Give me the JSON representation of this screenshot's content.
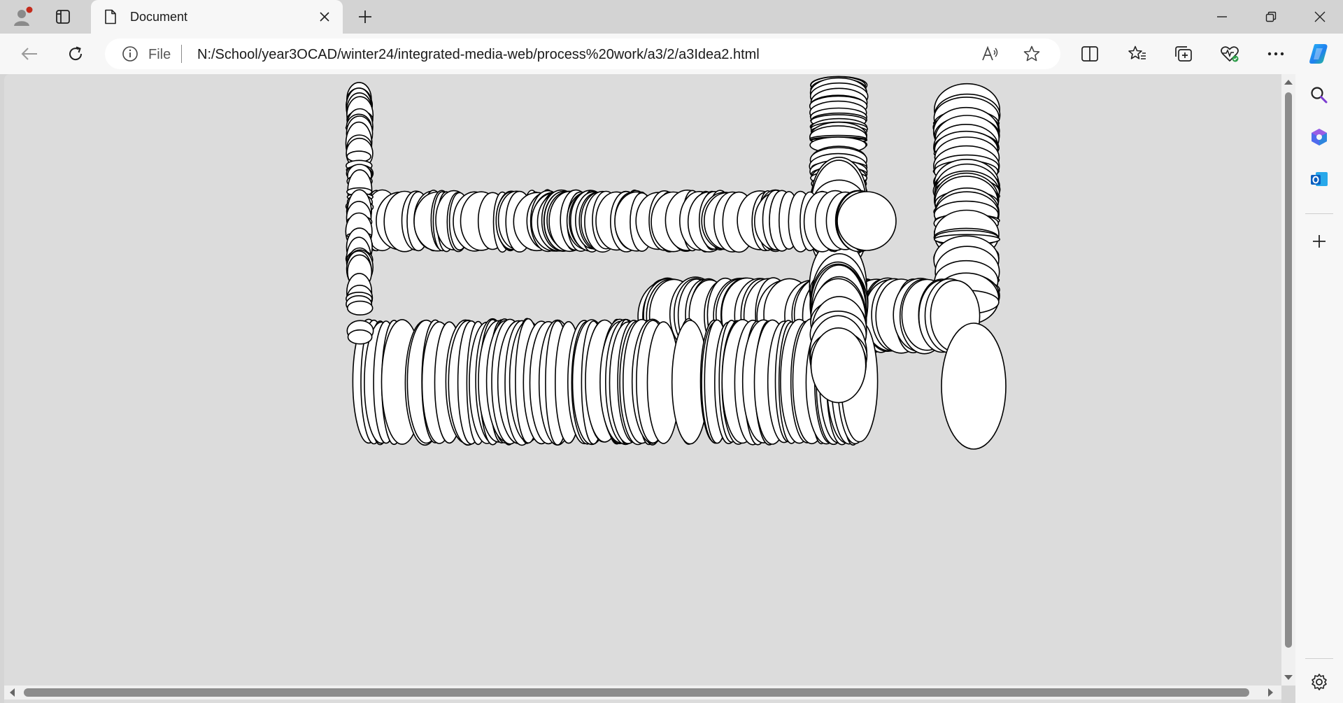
{
  "window": {
    "tab_title": "Document",
    "profile_icon": "profile-avatar-icon",
    "new_tab_icon": "plus-icon"
  },
  "toolbar": {
    "address_prefix": "File",
    "url": "N:/School/year3OCAD/winter24/integrated-media-web/process%20work/a3/2/a3Idea2.html"
  },
  "page": {
    "background_color": "#dcdcdc",
    "artwork": "rows of overlapping outlined white ellipses on grey background"
  },
  "colors": {
    "accent_notification": "#c42b1c",
    "tab_active": "#f7f7f7",
    "tabstrip": "#d3d3d3"
  }
}
